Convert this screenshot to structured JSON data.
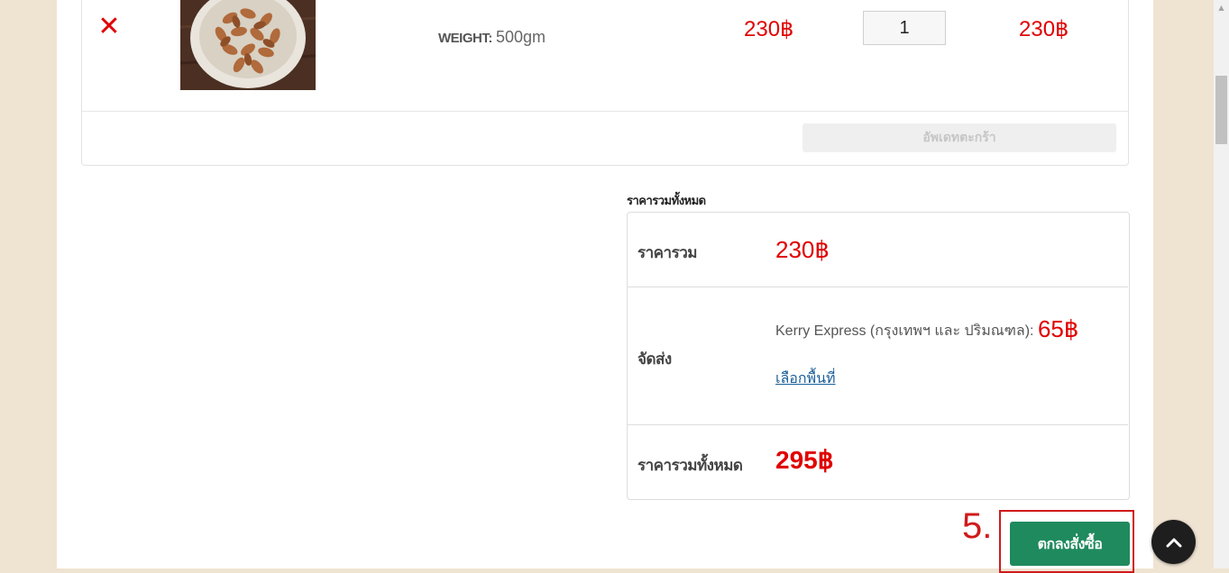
{
  "cart": {
    "item": {
      "image_alt": "Almonds in a bowl",
      "weight_label": "WEIGHT:",
      "weight_value": "500gm",
      "unit_price": "230฿",
      "quantity": "1",
      "subtotal": "230฿"
    },
    "update_button": "อัพเดทตะกร้า"
  },
  "totals": {
    "title": "ราคารวมทั้งหมด",
    "subtotal_label": "ราคารวม",
    "subtotal_value": "230฿",
    "shipping_label": "จัดส่ง",
    "shipping_method": "Kerry Express (กรุงเทพฯ และ ปริมณฑล): ",
    "shipping_price": "65฿",
    "choose_area_link": "เลือกพื้นที่",
    "total_label": "ราคารวมทั้งหมด",
    "total_value": "295฿"
  },
  "checkout": {
    "step_label": "5.",
    "button_label": "ตกลงสั่งซื้อ"
  },
  "colors": {
    "price_red": "#e00000",
    "checkout_green": "#1f8a5e",
    "annotation_red": "#d01a1a",
    "page_background": "#efe3d2"
  },
  "icons": {
    "remove": "close-icon",
    "back_to_top": "chevron-up-icon"
  }
}
